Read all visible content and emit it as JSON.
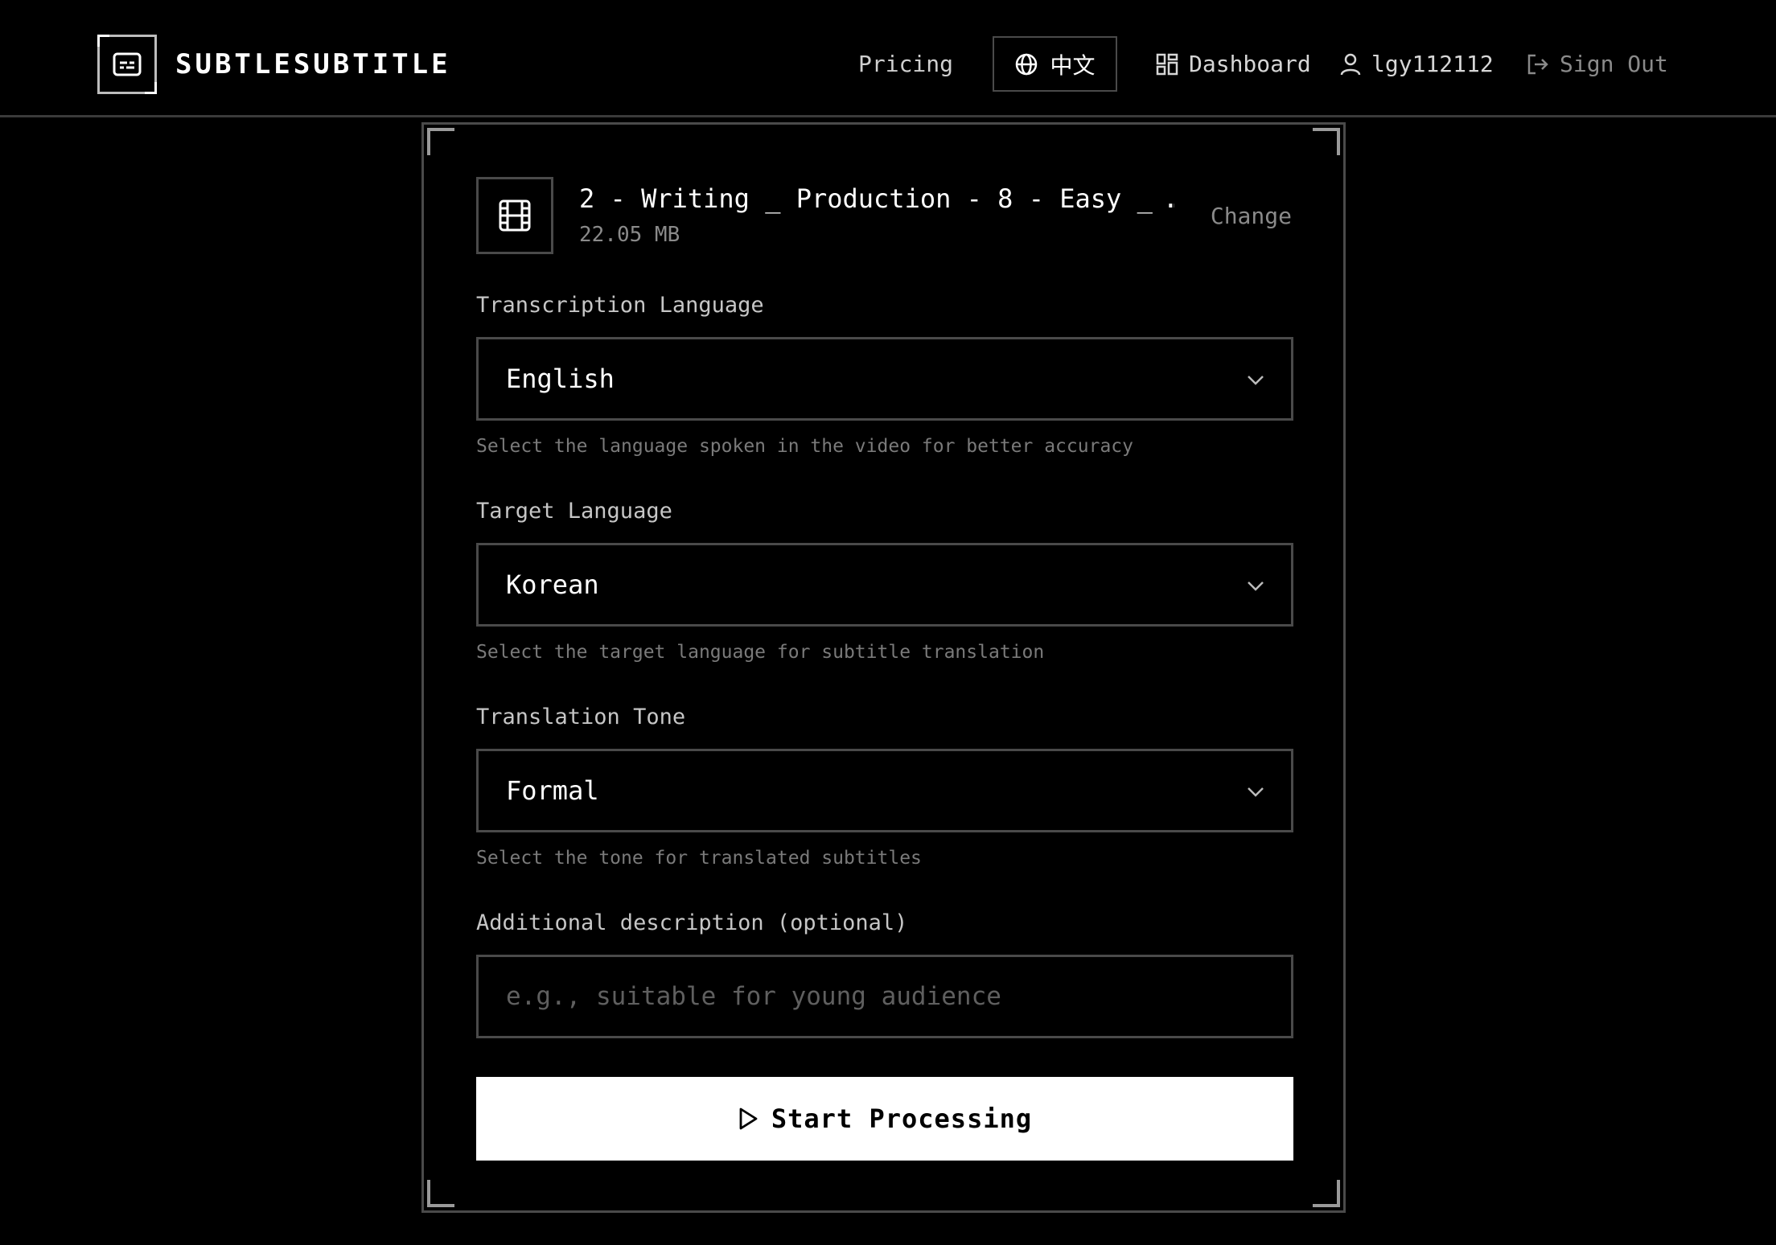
{
  "header": {
    "brand": "SUBTLESUBTITLE",
    "nav": {
      "pricing": "Pricing",
      "language": "中文",
      "dashboard": "Dashboard",
      "username": "lgy112112",
      "sign_out": "Sign Out"
    }
  },
  "file": {
    "name": "2 - Writing _ Production - 8 - Easy _ …",
    "size": "22.05 MB",
    "change_label": "Change"
  },
  "form": {
    "transcription": {
      "label": "Transcription Language",
      "value": "English",
      "help": "Select the language spoken in the video for better accuracy"
    },
    "target": {
      "label": "Target Language",
      "value": "Korean",
      "help": "Select the target language for subtitle translation"
    },
    "tone": {
      "label": "Translation Tone",
      "value": "Formal",
      "help": "Select the tone for translated subtitles"
    },
    "description": {
      "label": "Additional description (optional)",
      "placeholder": "e.g., suitable for young audience"
    },
    "submit_label": "Start Processing"
  },
  "colors": {
    "background": "#000000",
    "border": "#4a4a4a",
    "primary_button": "#ffffff",
    "muted_text": "#7a7a7a"
  },
  "icons": {
    "logo": "subtitles-icon",
    "language": "globe-icon",
    "dashboard": "grid-icon",
    "user": "user-icon",
    "sign_out": "logout-icon",
    "file": "film-icon",
    "select": "chevron-down-icon",
    "submit": "play-icon"
  }
}
